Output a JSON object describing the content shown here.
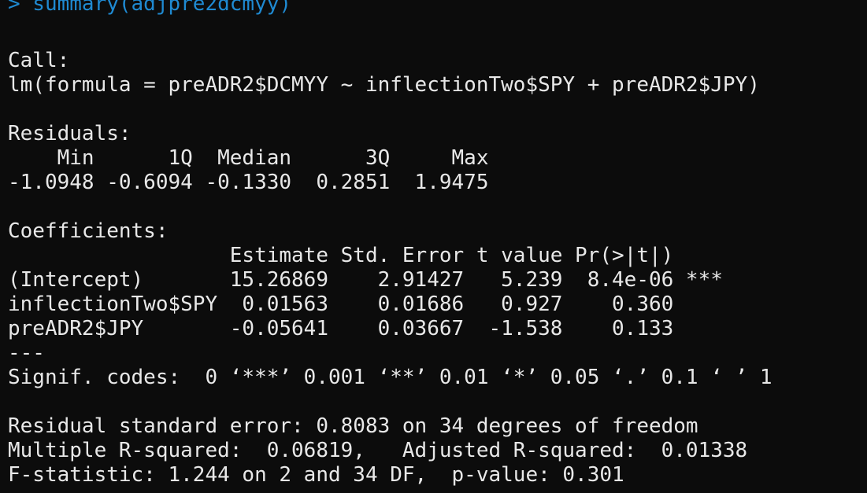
{
  "console": {
    "command": "> summary(adjpre2dcmyy)",
    "call_header": "Call:",
    "call_formula": "lm(formula = preADR2$DCMYY ~ inflectionTwo$SPY + preADR2$JPY)",
    "residuals_header": "Residuals:",
    "residuals_labels": "    Min      1Q  Median      3Q     Max ",
    "residuals_values": "-1.0948 -0.6094 -0.1330  0.2851  1.9475 ",
    "coefficients_header": "Coefficients:",
    "coef_table_header": "                  Estimate Std. Error t value Pr(>|t|)    ",
    "coef_rows": [
      "(Intercept)       15.26869    2.91427   5.239  8.4e-06 ***",
      "inflectionTwo$SPY  0.01563    0.01686   0.927    0.360    ",
      "preADR2$JPY       -0.05641    0.03667  -1.538    0.133    "
    ],
    "separator": "---",
    "signif_codes": "Signif. codes:  0 ‘***’ 0.001 ‘**’ 0.01 ‘*’ 0.05 ‘.’ 0.1 ‘ ’ 1",
    "residual_se": "Residual standard error: 0.8083 on 34 degrees of freedom",
    "r_squared": "Multiple R-squared:  0.06819,\tAdjusted R-squared:  0.01338 ",
    "f_statistic": "F-statistic: 1.244 on 2 and 34 DF,  p-value: 0.301"
  },
  "colors": {
    "background": "#0c0c0c",
    "output_text": "#e8e8e8",
    "command_text": "#1f8ad2"
  }
}
